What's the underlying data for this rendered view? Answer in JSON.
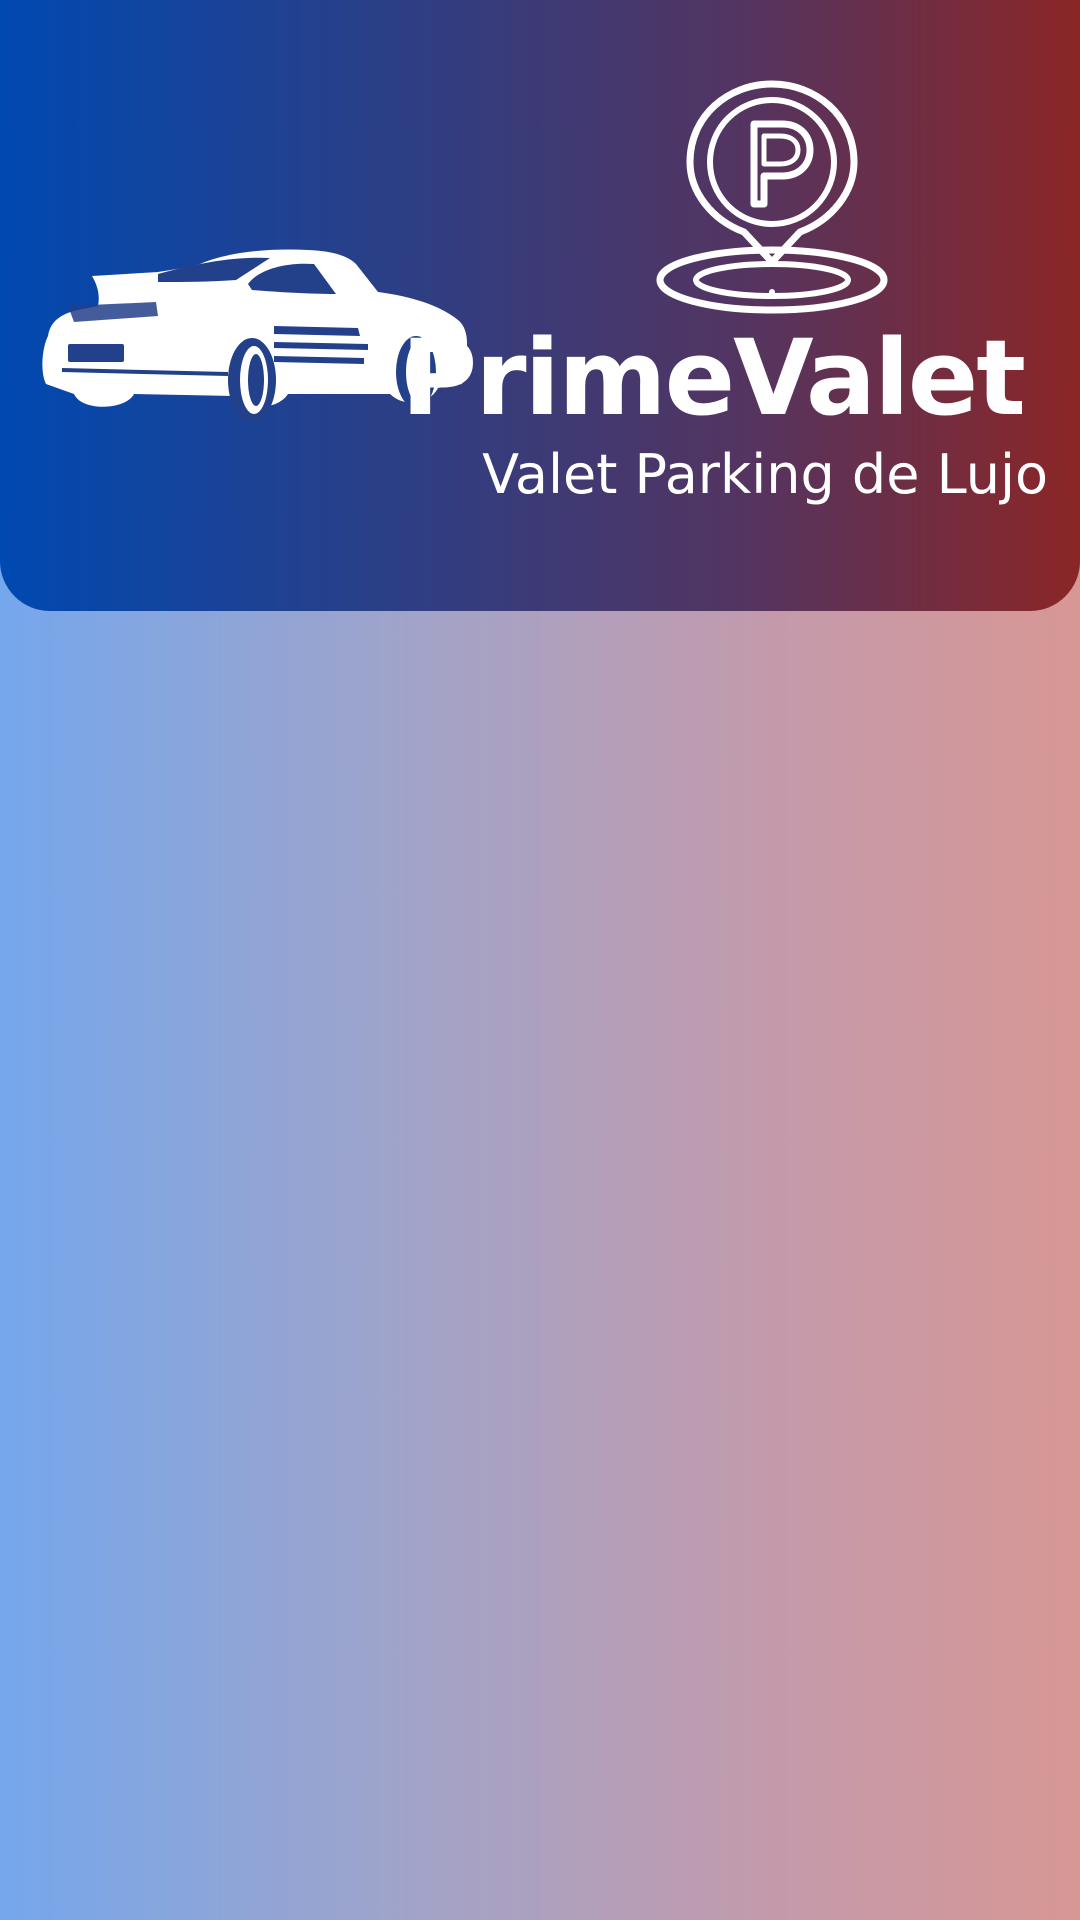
{
  "header": {
    "brand_name": "PrimeValet",
    "tagline": "Valet Parking de Lujo",
    "logo_icon": "parking-location-pin-icon",
    "car_illustration": "sports-car-icon"
  },
  "theme": {
    "header_gradient": [
      "#0049b1",
      "#2a3f87",
      "#55345f",
      "#8b2626"
    ],
    "background_gradient": [
      "#75a7ec",
      "#a3a3c7",
      "#c49aab",
      "#d79794"
    ],
    "text_color": "#ffffff"
  }
}
